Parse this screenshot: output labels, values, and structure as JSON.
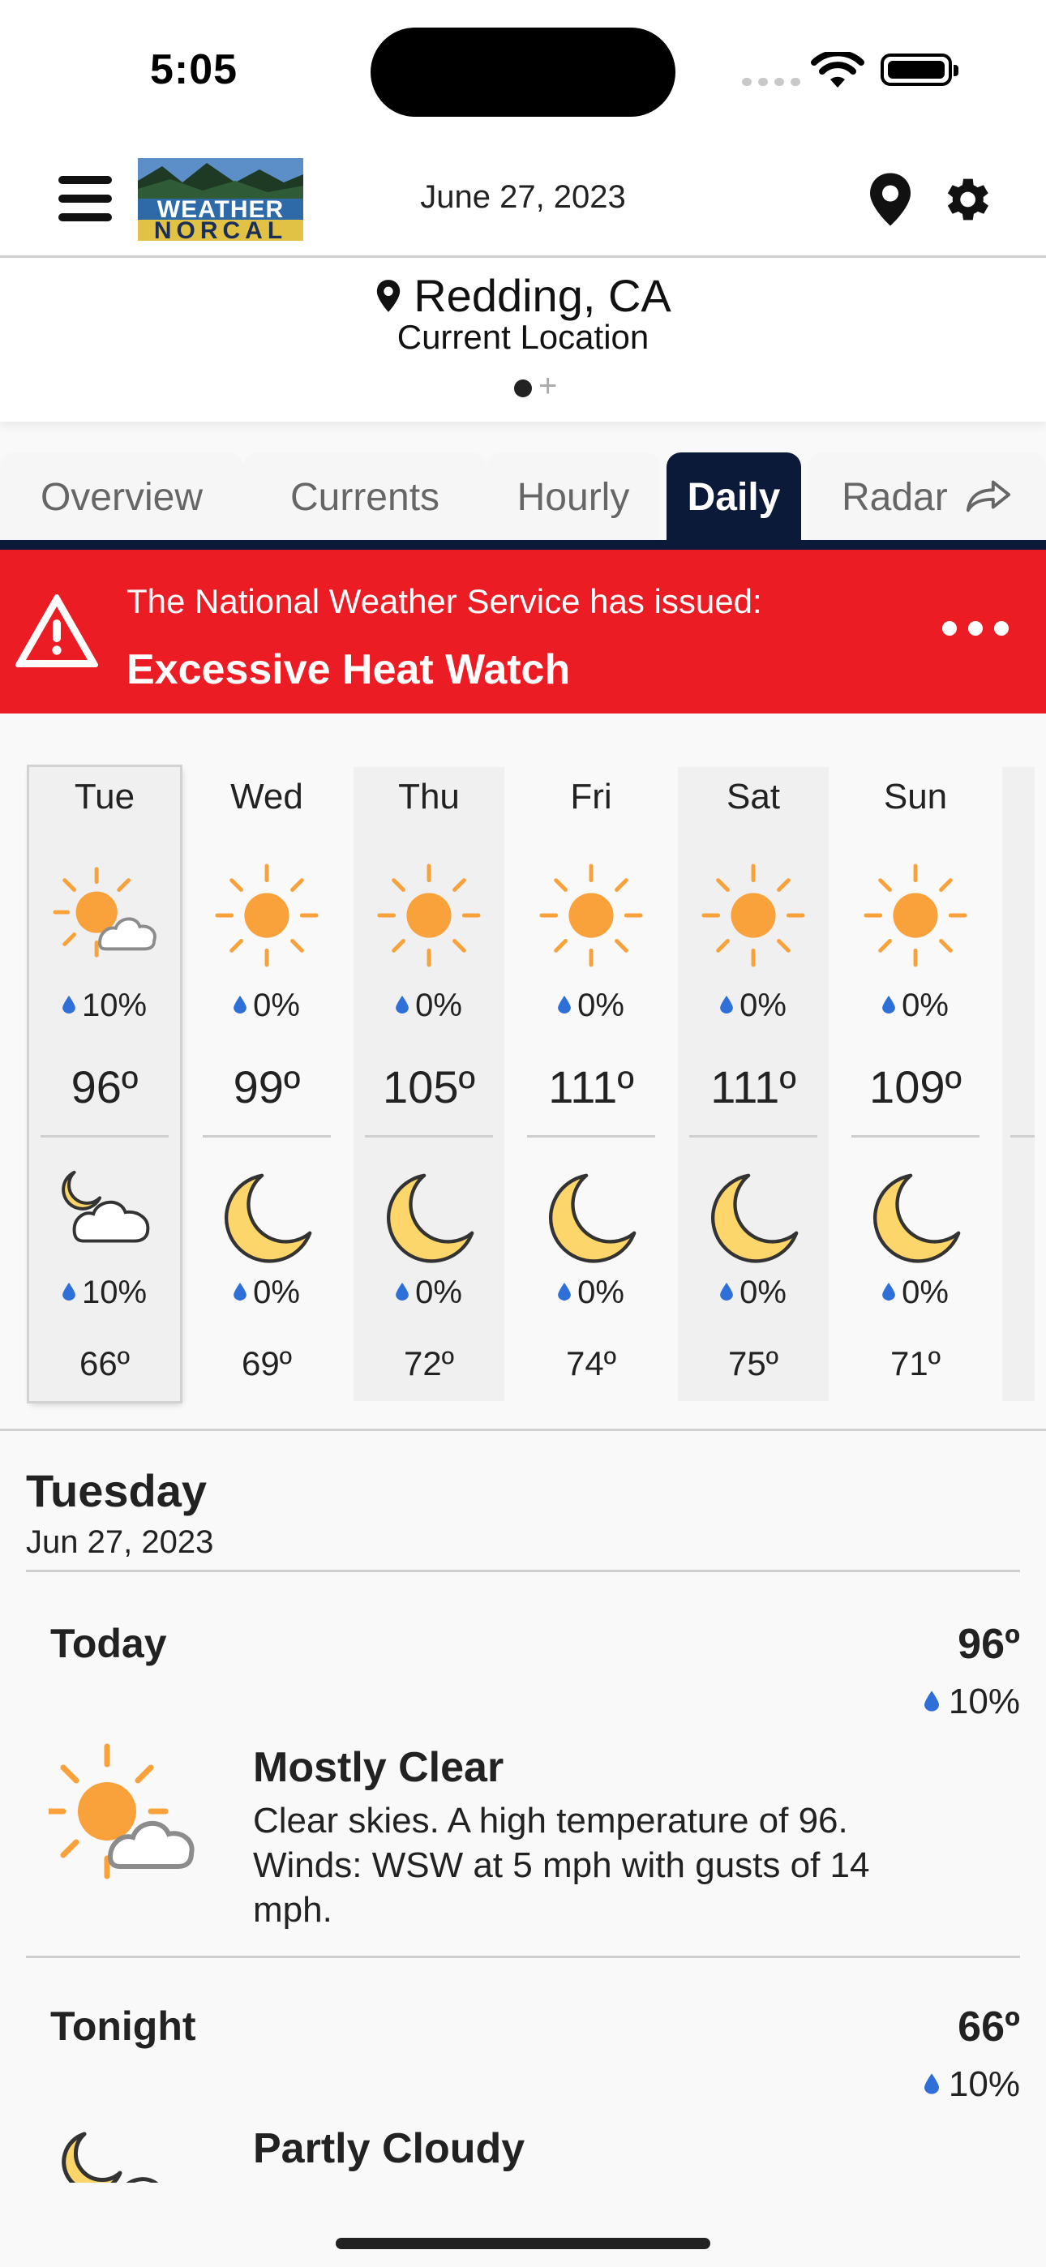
{
  "status": {
    "time": "5:05"
  },
  "header": {
    "date": "June 27, 2023",
    "logo_line1": "WEATHER",
    "logo_line2": "NORCAL"
  },
  "location": {
    "city": "Redding, CA",
    "subtitle": "Current Location",
    "add": "+"
  },
  "tabs": [
    "Overview",
    "Currents",
    "Hourly",
    "Daily",
    "Radar"
  ],
  "active_tab": "Daily",
  "alert": {
    "intro": "The National Weather Service has issued:",
    "title": "Excessive Heat Watch",
    "color": "#ec1c24"
  },
  "forecast": [
    {
      "day": "Tue",
      "day_icon": "partly-sunny-icon",
      "day_pop": "10%",
      "high": "96º",
      "night_icon": "partly-cloudy-night-icon",
      "night_pop": "10%",
      "low": "66º"
    },
    {
      "day": "Wed",
      "day_icon": "sun-icon",
      "day_pop": "0%",
      "high": "99º",
      "night_icon": "moon-icon",
      "night_pop": "0%",
      "low": "69º"
    },
    {
      "day": "Thu",
      "day_icon": "sun-icon",
      "day_pop": "0%",
      "high": "105º",
      "night_icon": "moon-icon",
      "night_pop": "0%",
      "low": "72º"
    },
    {
      "day": "Fri",
      "day_icon": "sun-icon",
      "day_pop": "0%",
      "high": "111º",
      "night_icon": "moon-icon",
      "night_pop": "0%",
      "low": "74º"
    },
    {
      "day": "Sat",
      "day_icon": "sun-icon",
      "day_pop": "0%",
      "high": "111º",
      "night_icon": "moon-icon",
      "night_pop": "0%",
      "low": "75º"
    },
    {
      "day": "Sun",
      "day_icon": "sun-icon",
      "day_pop": "0%",
      "high": "109º",
      "night_icon": "moon-icon",
      "night_pop": "0%",
      "low": "71º"
    }
  ],
  "detail": {
    "day": "Tuesday",
    "date": "Jun 27, 2023",
    "periods": [
      {
        "name": "Today",
        "temp": "96º",
        "pop": "10%",
        "icon": "partly-sunny-icon",
        "condition": "Mostly Clear",
        "description": "Clear skies. A high temperature of 96. Winds: WSW at 5 mph with gusts of 14 mph."
      },
      {
        "name": "Tonight",
        "temp": "66º",
        "pop": "10%",
        "icon": "partly-cloudy-night-icon",
        "condition": "Partly Cloudy",
        "description": ""
      }
    ]
  },
  "colors": {
    "nav": "#0c1a3a",
    "sun": "#f9a13a",
    "moon": "#fcd66b",
    "drop": "#2f6fd8"
  }
}
